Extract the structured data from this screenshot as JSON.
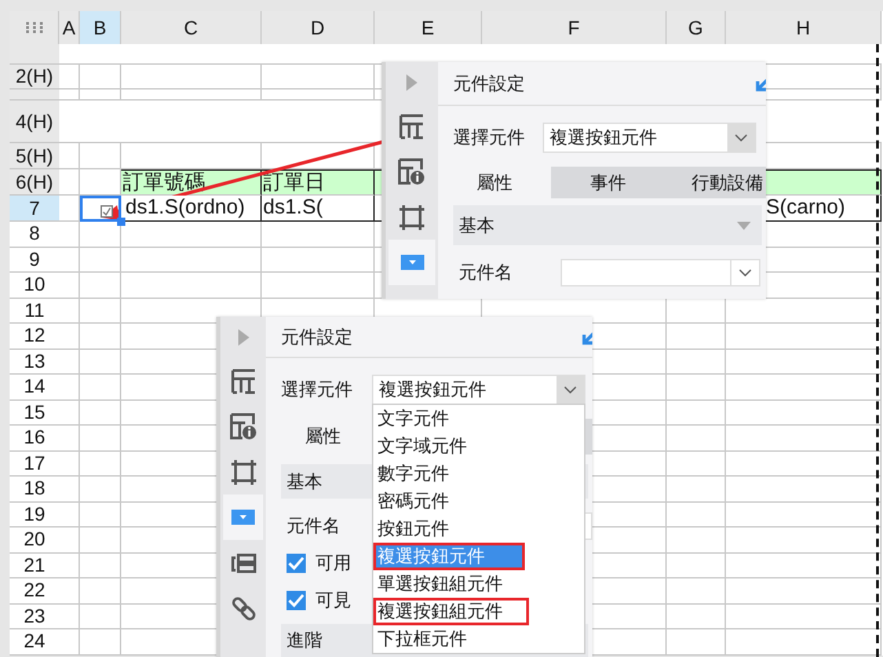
{
  "column_headers": [
    {
      "label": "A",
      "selected": false
    },
    {
      "label": "B",
      "selected": true
    },
    {
      "label": "C",
      "selected": false
    },
    {
      "label": "D",
      "selected": false
    },
    {
      "label": "E",
      "selected": false
    },
    {
      "label": "F",
      "selected": false
    },
    {
      "label": "G",
      "selected": false
    },
    {
      "label": "H",
      "selected": false
    }
  ],
  "rows": [
    {
      "kind": "merged",
      "frozen": true,
      "selected": false
    },
    {
      "header": "2(H)",
      "kind": "plain",
      "frozen": true,
      "selected": false
    },
    {
      "kind": "plain",
      "frozen": true,
      "selected": false
    },
    {
      "header": "4(H)",
      "kind": "merged",
      "frozen": true,
      "selected": false
    },
    {
      "header": "5(H)",
      "kind": "plain",
      "frozen": true,
      "selected": false
    },
    {
      "header": "6(H)",
      "kind": "green",
      "frozen": true,
      "selected": false,
      "cells": [
        null,
        null,
        {
          "text": "訂單號碼"
        },
        {
          "text": "訂單日"
        },
        null,
        null,
        null,
        null
      ]
    },
    {
      "header": "7",
      "kind": "fields",
      "frozen": false,
      "selected": true,
      "cells": [
        null,
        {
          "kind": "widget",
          "selected": true
        },
        {
          "text": "ds1.S(ordno)"
        },
        {
          "text": "ds1.S("
        },
        null,
        null,
        null,
        {
          "text": "S(carno)",
          "kind": "clipped"
        }
      ]
    },
    {
      "header": "8",
      "kind": "plain",
      "frozen": false,
      "selected": false
    },
    {
      "header": "9",
      "kind": "plain",
      "frozen": false,
      "selected": false
    },
    {
      "header": "10",
      "kind": "plain",
      "frozen": false,
      "selected": false
    },
    {
      "header": "11",
      "kind": "plain",
      "frozen": false,
      "selected": false
    },
    {
      "header": "12",
      "kind": "plain",
      "frozen": false,
      "selected": false
    },
    {
      "header": "13",
      "kind": "plain",
      "frozen": false,
      "selected": false
    },
    {
      "header": "14",
      "kind": "plain",
      "frozen": false,
      "selected": false
    },
    {
      "header": "15",
      "kind": "plain",
      "frozen": false,
      "selected": false
    },
    {
      "header": "16",
      "kind": "plain",
      "frozen": false,
      "selected": false
    },
    {
      "header": "17",
      "kind": "plain",
      "frozen": false,
      "selected": false
    },
    {
      "header": "18",
      "kind": "plain",
      "frozen": false,
      "selected": false
    },
    {
      "header": "19",
      "kind": "plain",
      "frozen": false,
      "selected": false
    },
    {
      "header": "20",
      "kind": "plain",
      "frozen": false,
      "selected": false
    },
    {
      "header": "21",
      "kind": "plain",
      "frozen": false,
      "selected": false
    },
    {
      "header": "22",
      "kind": "plain",
      "frozen": false,
      "selected": false
    },
    {
      "header": "23",
      "kind": "plain",
      "frozen": false,
      "selected": false
    },
    {
      "header": "24",
      "kind": "plain",
      "frozen": false,
      "selected": false
    }
  ],
  "panels": [
    {
      "title": "元件設定",
      "sidebar": [
        {
          "kind": "expand",
          "selected": false
        },
        {
          "kind": "grid",
          "selected": false
        },
        {
          "kind": "info",
          "selected": false
        },
        {
          "kind": "frame",
          "selected": false
        },
        {
          "kind": "widget",
          "selected": true
        }
      ],
      "select_label": "選擇元件",
      "select_value": "複選按鈕元件",
      "tabs": [
        {
          "label": "屬性",
          "selected": true
        },
        {
          "label": "事件",
          "selected": false
        },
        {
          "label": "行動設備",
          "selected": false
        }
      ],
      "section": "基本",
      "field_label": "元件名"
    },
    {
      "title": "元件設定",
      "sidebar": [
        {
          "kind": "expand",
          "selected": false
        },
        {
          "kind": "grid",
          "selected": false
        },
        {
          "kind": "info",
          "selected": false
        },
        {
          "kind": "frame",
          "selected": false
        },
        {
          "kind": "widget",
          "selected": true
        },
        {
          "kind": "form",
          "selected": false
        },
        {
          "kind": "link",
          "selected": false
        }
      ],
      "select_label": "選擇元件",
      "select_value": "複選按鈕元件",
      "tabs": [
        {
          "label": "屬性",
          "selected": true
        }
      ],
      "section": "基本",
      "field_label": "元件名",
      "checkboxes": [
        {
          "label": "可用",
          "checked": true
        },
        {
          "label": "可見",
          "checked": true
        }
      ],
      "section_2": "進階",
      "dropdown": [
        {
          "label": "文字元件",
          "selected": false,
          "outlined": false
        },
        {
          "label": "文字域元件",
          "selected": false,
          "outlined": false
        },
        {
          "label": "數字元件",
          "selected": false,
          "outlined": false
        },
        {
          "label": "密碼元件",
          "selected": false,
          "outlined": false
        },
        {
          "label": "按鈕元件",
          "selected": false,
          "outlined": false
        },
        {
          "label": "複選按鈕元件",
          "selected": true,
          "outlined": true
        },
        {
          "label": "單選按鈕組元件",
          "selected": false,
          "outlined": false
        },
        {
          "label": "複選按鈕組元件",
          "selected": false,
          "outlined": true
        },
        {
          "label": "下拉框元件",
          "selected": false,
          "outlined": false
        }
      ]
    }
  ]
}
